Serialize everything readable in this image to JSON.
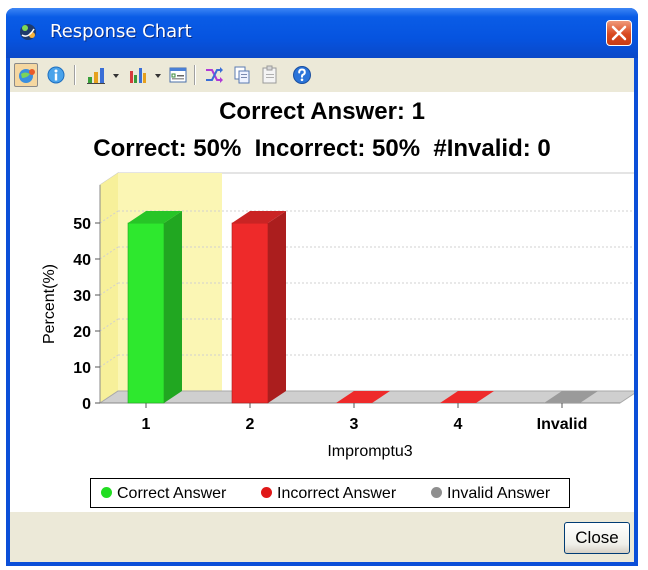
{
  "window": {
    "title": "Response Chart"
  },
  "toolbar": {
    "buttons": [
      {
        "icon": "globe-users-icon",
        "pressed": true
      },
      {
        "icon": "info-circle-icon"
      },
      {
        "icon": "bar-chart-icon"
      },
      {
        "icon": "dropdown-arrow-icon"
      },
      {
        "icon": "column-chart-icon"
      },
      {
        "icon": "dropdown-arrow-icon"
      },
      {
        "icon": "form-settings-icon"
      },
      {
        "icon": "shuffle-icon"
      },
      {
        "icon": "copy-icon"
      },
      {
        "icon": "paste-icon"
      },
      {
        "icon": "help-icon"
      }
    ]
  },
  "chart": {
    "title_line1": "Correct Answer: 1",
    "title_line2": "Correct: 50%  Incorrect: 50%  #Invalid: 0",
    "ylabel": "Percent(%)",
    "xlabel": "Impromptu3"
  },
  "chart_data": {
    "type": "bar",
    "categories": [
      "1",
      "2",
      "3",
      "4",
      "Invalid"
    ],
    "values": [
      50,
      50,
      0,
      0,
      0
    ],
    "colors": [
      "#2ee82e",
      "#ee2a2a",
      "#ee2a2a",
      "#ee2a2a",
      "#9a9a9a"
    ],
    "highlight_category": "1",
    "ylim": [
      0,
      55
    ],
    "yticks": [
      0,
      10,
      20,
      30,
      40,
      50
    ],
    "title": "Correct Answer: 1",
    "xlabel": "Impromptu3",
    "ylabel": "Percent(%)",
    "grid": true,
    "legend_position": "bottom",
    "legend": [
      {
        "label": "Correct Answer",
        "color": "#22dd22"
      },
      {
        "label": "Incorrect Answer",
        "color": "#e01818"
      },
      {
        "label": "Invalid Answer",
        "color": "#8f8f8f"
      }
    ]
  },
  "footer": {
    "close_label": "Close"
  }
}
